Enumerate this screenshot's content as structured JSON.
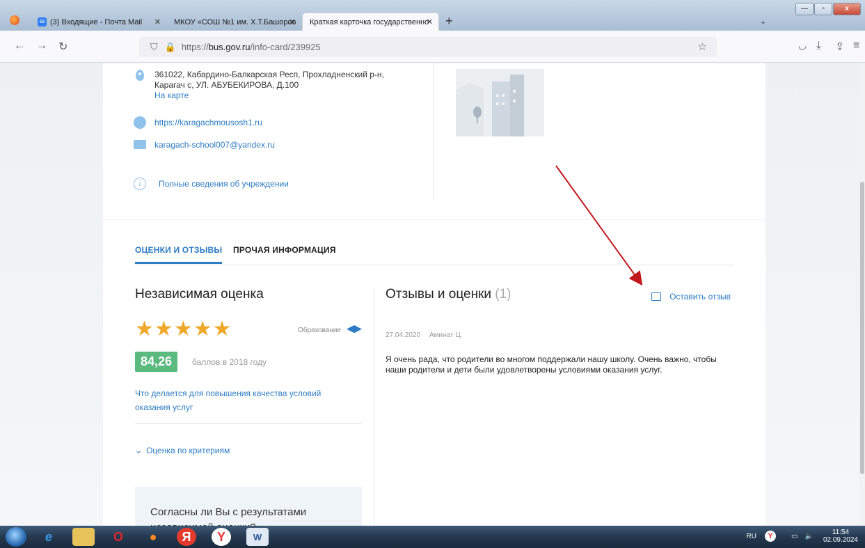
{
  "browser": {
    "tabs": [
      {
        "label": "(3) Входящие - Почта Mail",
        "active": false
      },
      {
        "label": "МКОУ «СОШ №1 им. Х.Т.Башоров",
        "active": false
      },
      {
        "label": "Краткая карточка государственно",
        "active": true
      }
    ],
    "url_prefix": "https://",
    "url_domain": "bus.gov.ru",
    "url_path": "/info-card/239925"
  },
  "institution": {
    "address_line1": "361022, Кабардино-Балкарская Респ, Прохладненский р-н,",
    "address_line2": "Карагач с, УЛ. АБУБЕКИРОВА, Д.100",
    "map_link": "На карте",
    "website": "https://karagachmousosh1.ru",
    "email": "karagach-school007@yandex.ru",
    "full_info_link": "Полные сведения об учреждении"
  },
  "tabs": {
    "ratings": "ОЦЕНКИ И ОТЗЫВЫ",
    "other": "ПРОЧАЯ ИНФОРМАЦИЯ"
  },
  "independent": {
    "title": "Независимая оценка",
    "stars": 5,
    "category": "Образование",
    "score": "84,26",
    "score_note": "баллов в 2018 году",
    "quality_link": "Что делается для повышения качества условий оказания услуг",
    "criteria_link": "Оценка по критериям",
    "agree_text": "Согласны ли Вы с результатами независимой оценки?"
  },
  "reviews": {
    "title": "Отзывы и оценки",
    "count": "(1)",
    "leave_review": "Оставить отзыв",
    "items": [
      {
        "date": "27.04.2020",
        "author": "Аминат Ц.",
        "text": "Я очень рада, что родители во многом поддержали нашу школу. Очень важно, чтобы наши родители и дети были удовлетворены условиями оказания услуг."
      }
    ]
  },
  "taskbar": {
    "lang": "RU",
    "time": "11:54",
    "date": "02.09.2024"
  },
  "colors": {
    "accent": "#2d7cc4",
    "star": "#f0a82b",
    "score_bg": "#5bba7e",
    "annotation_arrow": "#c0181c"
  }
}
